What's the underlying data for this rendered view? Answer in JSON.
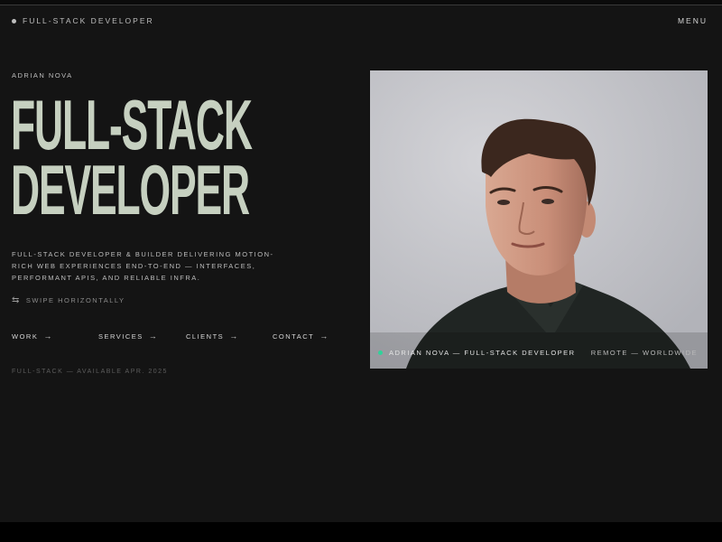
{
  "header": {
    "brand": "FULL-STACK DEVELOPER",
    "menu_label": "MENU"
  },
  "hero": {
    "name": "ADRIAN NOVA",
    "headline_line1": "FULL-STACK",
    "headline_line2": "DEVELOPER",
    "description": "FULL-STACK DEVELOPER & BUILDER DELIVERING MOTION-RICH WEB EXPERIENCES END-TO-END — INTERFACES, PERFORMANT APIS, AND RELIABLE INFRA.",
    "swipe_hint": "SWIPE HORIZONTALLY",
    "swipe_icon": "swap-arrows-icon",
    "availability": "FULL-STACK — AVAILABLE APR. 2025"
  },
  "nav": {
    "items": [
      {
        "label": "WORK",
        "icon": "arrow-right-icon"
      },
      {
        "label": "SERVICES",
        "icon": "arrow-right-icon"
      },
      {
        "label": "CLIENTS",
        "icon": "arrow-right-icon"
      },
      {
        "label": "CONTACT",
        "icon": "arrow-right-icon"
      }
    ]
  },
  "photo": {
    "caption_left": "ADRIAN NOVA — FULL-STACK DEVELOPER",
    "caption_right": "REMOTE — WORLDWIDE",
    "status_color": "#2fd39a"
  },
  "colors": {
    "background": "#141414",
    "headline": "#c6d0c0",
    "text": "#bdbdbd"
  }
}
